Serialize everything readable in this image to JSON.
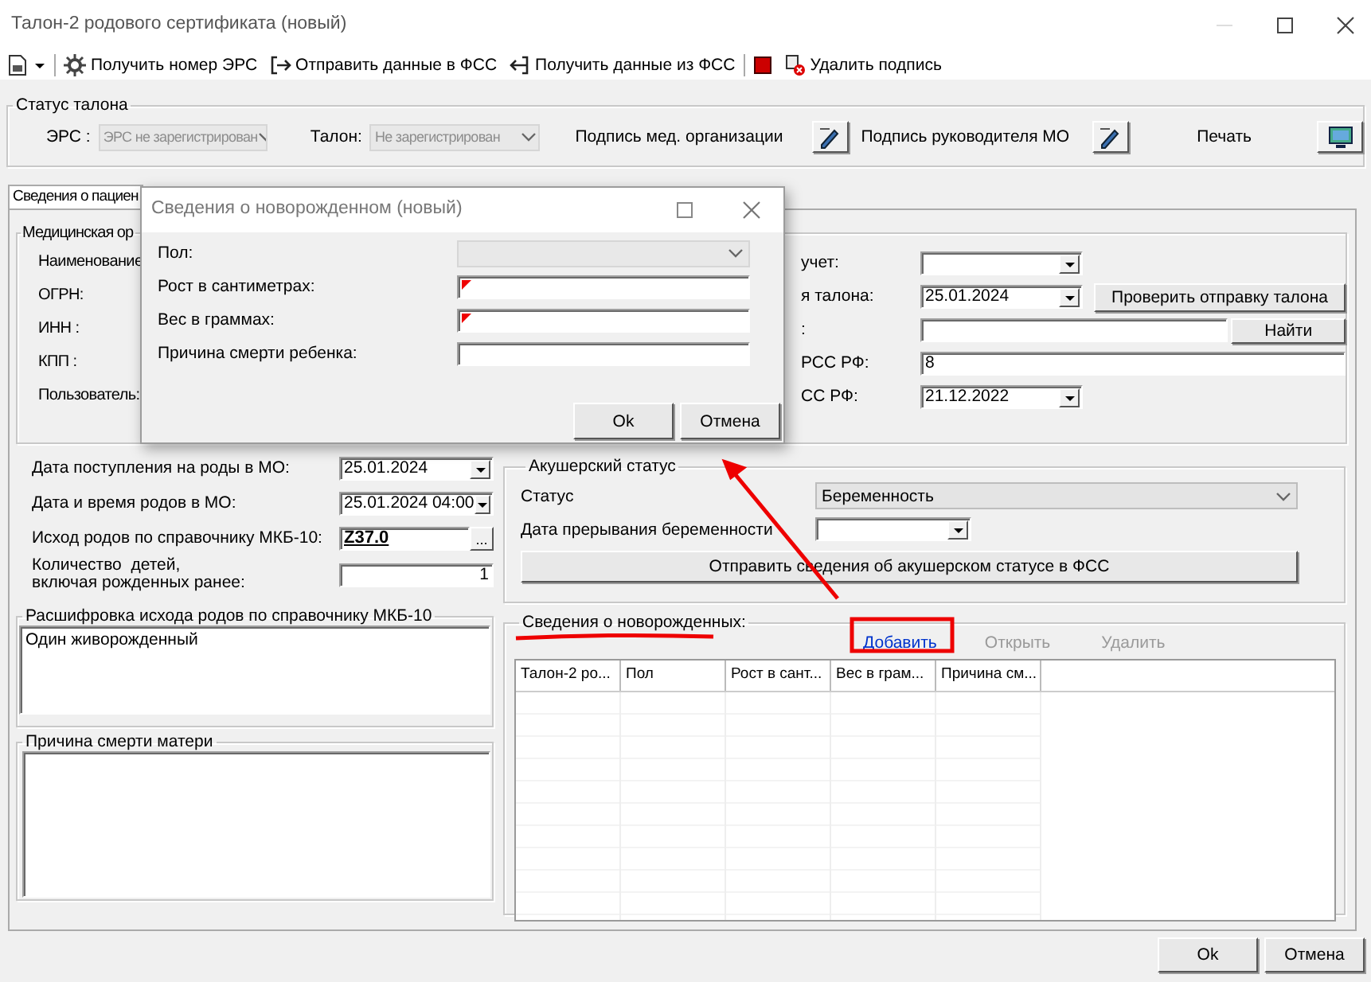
{
  "window": {
    "title": "Талон-2 родового сертификата (новый)"
  },
  "toolbar": [
    {
      "kind": "menu"
    },
    {
      "kind": "separator"
    },
    {
      "kind": "button",
      "label": "Получить номер ЭРС"
    },
    {
      "kind": "button",
      "label": "Отправить данные в ФСС"
    },
    {
      "kind": "button",
      "label": "Получить данные из ФСС"
    },
    {
      "kind": "separator"
    },
    {
      "kind": "icon"
    },
    {
      "kind": "button",
      "label": "Удалить подпись"
    }
  ],
  "status": {
    "title": "Статус талона",
    "fields": [
      {
        "label": "ЭРС :",
        "value": "ЭРС не зарегистрирован",
        "kind": "flat",
        "disabled": true
      },
      {
        "label": "Талон:",
        "value": "Не зарегистрирован",
        "kind": "flat",
        "disabled": true
      }
    ],
    "actions": [
      {
        "label": "Подпись мед. организации"
      },
      {
        "label": "Подпись руководителя МО"
      },
      {
        "label": "Печать"
      }
    ]
  },
  "tabs": [
    {
      "label": "Сведения о пациен",
      "selected": true
    }
  ],
  "organization": {
    "title": "Медицинская ор",
    "labels": [
      "Наименование",
      "ОГРН:",
      "ИНН :",
      "КПП :",
      "Пользователь:"
    ],
    "rows": [
      {
        "label": "учет:",
        "kind": "classic",
        "disabled": false
      },
      {
        "label": "я талона:",
        "kind": "classic",
        "value": "25.01.2024",
        "button": "Проверить отправку талона",
        "disabled": false
      },
      {
        "label": ":",
        "kind": "text",
        "button": "Найти",
        "disabled": false
      },
      {
        "label": "РСС РФ:",
        "kind": "text",
        "value": "8",
        "disabled": false
      },
      {
        "label": "СС РФ:",
        "kind": "classic",
        "value": "21.12.2022",
        "disabled": false
      }
    ]
  },
  "birth": {
    "rows": [
      {
        "label": "Дата поступления на роды в МО:",
        "kind": "classic",
        "value": "25.01.2024",
        "disabled": false
      },
      {
        "label": "Дата и время родов в МО:",
        "kind": "classic",
        "value": "25.01.2024 04:00",
        "disabled": false
      },
      {
        "label": "Исход родов по справочнику МКБ-10:",
        "kind": "lookup",
        "value": "Z37.0",
        "button": "...",
        "disabled": false
      },
      {
        "label": "Количество  детей,\nвключая рожденных ранее:",
        "kind": "number",
        "value": "1",
        "disabled": false
      }
    ]
  },
  "outcome": {
    "title": "Расшифровка исхода родов по справочнику МКБ-10",
    "text": "Один живорожденный"
  },
  "mother_death": {
    "title": "Причина смерти матери"
  },
  "obstetric": {
    "title": "Акушерский статус",
    "rows": [
      {
        "label": "Статус",
        "kind": "flat",
        "value": "Беременность",
        "disabled": false
      },
      {
        "label": "Дата прерывания беременности",
        "kind": "classic",
        "disabled": false
      }
    ],
    "button": "Отправить сведения  об акушерском статусе в ФСС"
  },
  "newborns": {
    "title": "Сведения о новорожденных:",
    "actions": [
      {
        "label": "Добавить",
        "disabled": false
      },
      {
        "label": "Открыть",
        "disabled": true
      },
      {
        "label": "Удалить",
        "disabled": true
      }
    ],
    "columns": [
      "Талон-2 ро...",
      "Пол",
      "Рост в сант...",
      "Вес в грам...",
      "Причина см..."
    ]
  },
  "buttons": [
    "Ok",
    "Отмена"
  ],
  "dialog": {
    "title": "Сведения о новорожденном (новый)",
    "fields": [
      {
        "label": "Пол:",
        "kind": "flat",
        "disabled": true,
        "required": false
      },
      {
        "label": "Рост в сантиметрах:",
        "kind": "text",
        "disabled": false,
        "required": true
      },
      {
        "label": "Вес в граммах:",
        "kind": "text",
        "disabled": false,
        "required": true
      },
      {
        "label": "Причина смерти ребенка:",
        "kind": "text",
        "disabled": false,
        "required": false
      }
    ],
    "buttons": [
      "Ok",
      "Отмена"
    ]
  }
}
